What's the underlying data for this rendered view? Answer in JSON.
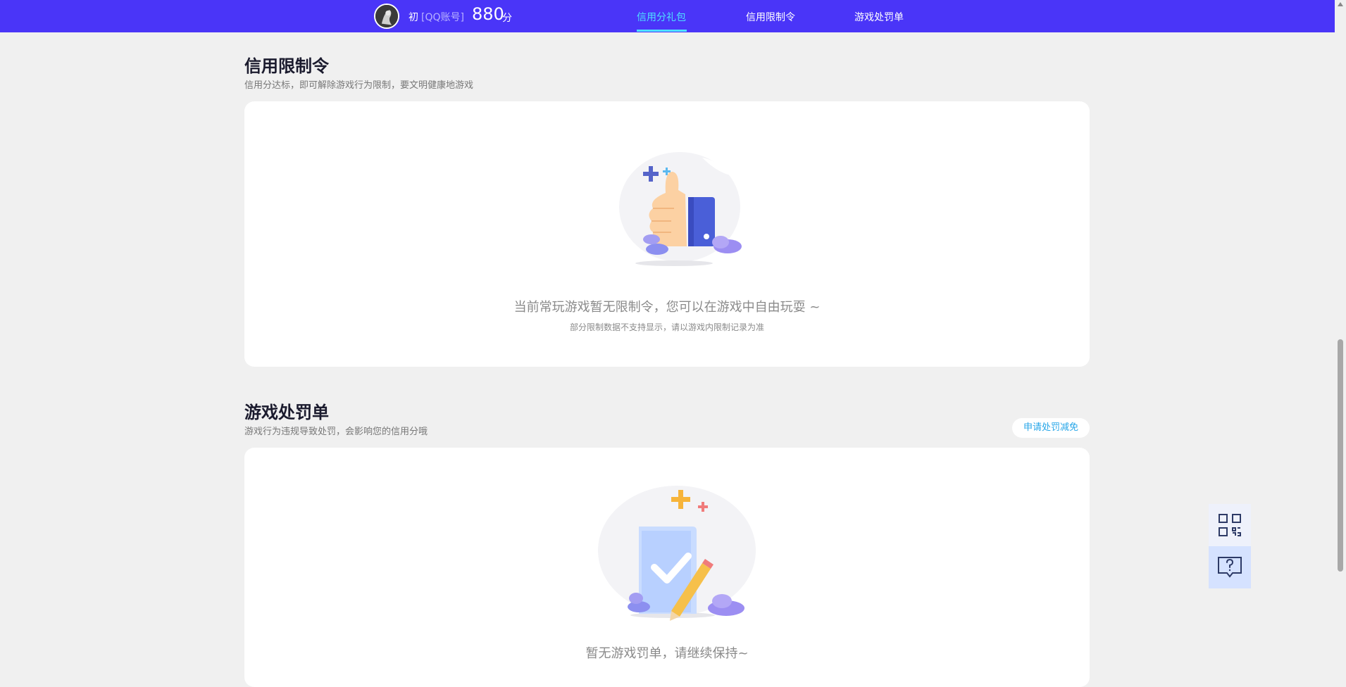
{
  "header": {
    "user_name": "初",
    "account_type": "[QQ账号]",
    "score": "880",
    "score_unit": "分",
    "nav": [
      {
        "label": "信用分礼包",
        "active": true
      },
      {
        "label": "信用限制令",
        "active": false
      },
      {
        "label": "游戏处罚单",
        "active": false
      }
    ]
  },
  "restriction": {
    "title": "信用限制令",
    "subtitle": "信用分达标，即可解除游戏行为限制，要文明健康地游戏",
    "empty_main": "当前常玩游戏暂无限制令，您可以在游戏中自由玩耍 ~",
    "empty_sub": "部分限制数据不支持显示，请以游戏内限制记录为准"
  },
  "penalty": {
    "title": "游戏处罚单",
    "subtitle": "游戏行为违规导致处罚，会影响您的信用分哦",
    "apply_button": "申请处罚减免",
    "empty_main": "暂无游戏罚单，请继续保持~"
  },
  "colors": {
    "topbar": "#4a35f8",
    "nav_active": "#4ee0ff",
    "link": "#27a6e8"
  },
  "icons": [
    "avatar",
    "thumbs-up-illustration",
    "clipboard-check-illustration",
    "qr-code-icon",
    "help-chat-icon"
  ]
}
